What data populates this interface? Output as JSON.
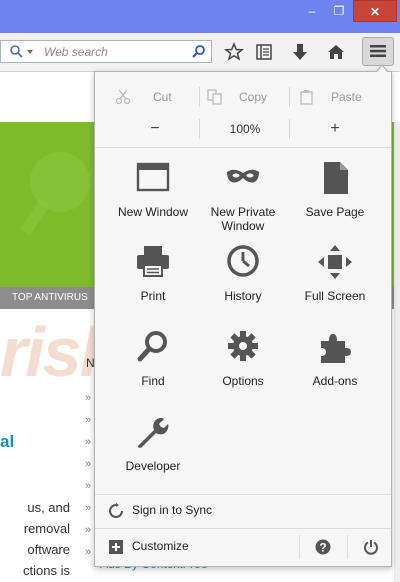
{
  "window": {
    "minimize_glyph": "–",
    "maximize_glyph": "❐",
    "close_glyph": "✕"
  },
  "toolbar": {
    "search": {
      "placeholder": "Web search"
    },
    "icons": [
      "bookmark-star-icon",
      "reading-list-icon",
      "download-icon",
      "home-icon",
      "hamburger-menu-icon"
    ]
  },
  "page": {
    "nav_label": "TOP ANTIVIRUS",
    "watermark": "risk.com",
    "heading_fragment": "al",
    "n_fragment": "N",
    "text_fragments": [
      "us, and",
      "removal",
      "oftware",
      "ctions is"
    ],
    "ads_text": "Ads By ContextFree"
  },
  "menu": {
    "edit": {
      "cut": "Cut",
      "copy": "Copy",
      "paste": "Paste"
    },
    "zoom": {
      "minus": "−",
      "value": "100%",
      "plus": "+"
    },
    "items": [
      {
        "label": "New Window",
        "icon": "new-window-icon"
      },
      {
        "label": "New Private Window",
        "icon": "private-mask-icon"
      },
      {
        "label": "Save Page",
        "icon": "save-page-icon"
      },
      {
        "label": "Print",
        "icon": "printer-icon"
      },
      {
        "label": "History",
        "icon": "history-clock-icon"
      },
      {
        "label": "Full Screen",
        "icon": "fullscreen-icon"
      },
      {
        "label": "Find",
        "icon": "find-magnifier-icon"
      },
      {
        "label": "Options",
        "icon": "options-gear-icon"
      },
      {
        "label": "Add-ons",
        "icon": "addons-puzzle-icon"
      },
      {
        "label": "Developer",
        "icon": "developer-wrench-icon"
      }
    ],
    "sync_label": "Sign in to Sync",
    "customize_label": "Customize",
    "help_icon": "help-icon",
    "quit_icon": "power-icon"
  },
  "colors": {
    "titlebar": "#6d84f0",
    "close_button": "#c9453a",
    "page_green": "#7dbb2d",
    "link_blue": "#1a8fb8"
  }
}
